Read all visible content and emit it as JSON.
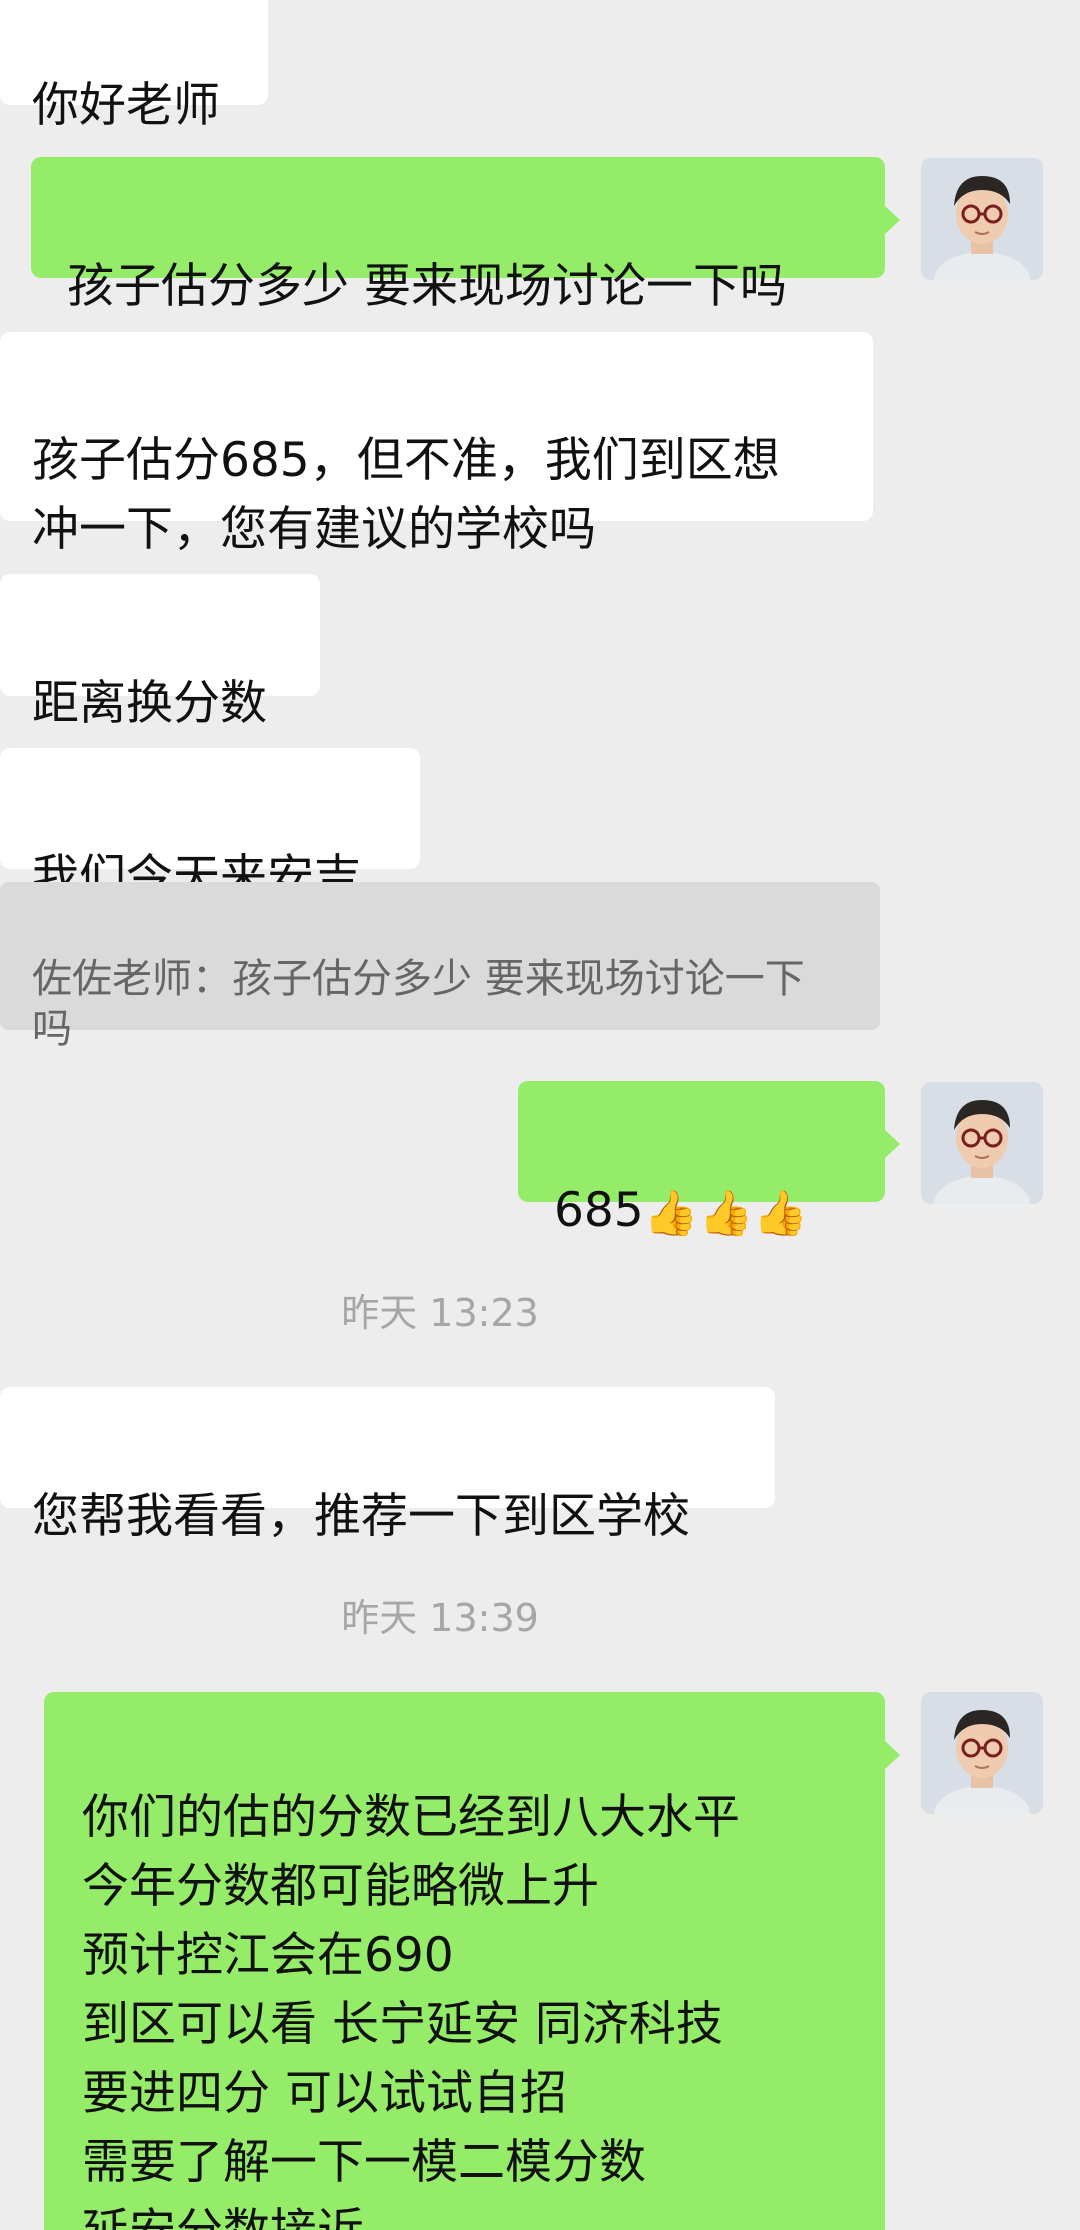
{
  "messages": {
    "m1": "你好老师",
    "m2": "孩子估分多少  要来现场讨论一下吗",
    "m3": "孩子估分685，但不准，我们到区想\n冲一下，您有建议的学校吗",
    "m4": "距离换分数",
    "m5": "我们今天来安吉",
    "quote": "佐佐老师：孩子估分多少  要来现场讨论一下\n吗",
    "m6_text": "685",
    "m6_emoji": "👍👍👍",
    "time1": "昨天 13:23",
    "m7": "您帮我看看，推荐一下到区学校",
    "time2": "昨天 13:39",
    "m8": "你们的估的分数已经到八大水平\n今年分数都可能略微上升\n预计控江会在690\n到区可以看 长宁延安 同济科技\n要进四分 可以试试自招\n需要了解一下一模二模分数\n延安分数接近\n同济科技 四校四分的分数不会涨很"
  },
  "colors": {
    "background": "#ededed",
    "incoming_bubble": "#ffffff",
    "outgoing_bubble": "#95ec69",
    "quote_bubble": "#dadada",
    "timestamp": "#a6a6a6"
  },
  "icons": {
    "avatar": "user-avatar-icon",
    "thumbs": "thumbs-up-icon"
  }
}
